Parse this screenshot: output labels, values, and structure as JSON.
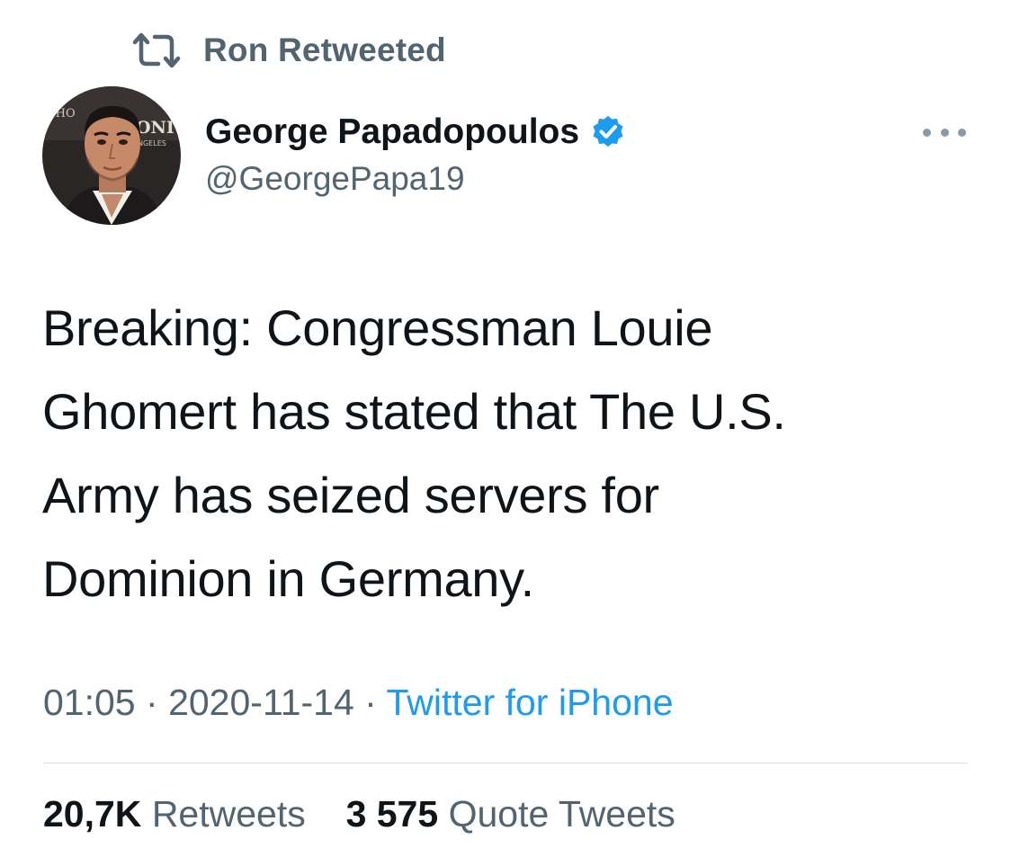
{
  "social_context": {
    "icon": "retweet-icon",
    "label": "Ron Retweeted"
  },
  "author": {
    "avatar": "profile-photo",
    "display_name": "George Papadopoulos",
    "verified_icon": "verified-badge-icon",
    "handle": "@GeorgePapa19"
  },
  "menu": {
    "icon": "more-options-icon"
  },
  "tweet": {
    "text": "Breaking: Congressman Louie\nGhomert has stated that The U.S.\nArmy has seized servers for\nDominion in Germany."
  },
  "meta": {
    "time": "01:05",
    "separator": "·",
    "date": "2020-11-14",
    "source": "Twitter for iPhone"
  },
  "stats": {
    "retweets_count": "20,7K",
    "retweets_label": "Retweets",
    "quotes_count": "3 575",
    "quotes_label": "Quote Tweets"
  },
  "colors": {
    "text": "#0f1419",
    "secondary": "#536471",
    "link": "#1d9bf0",
    "divider": "#d9dde1"
  }
}
